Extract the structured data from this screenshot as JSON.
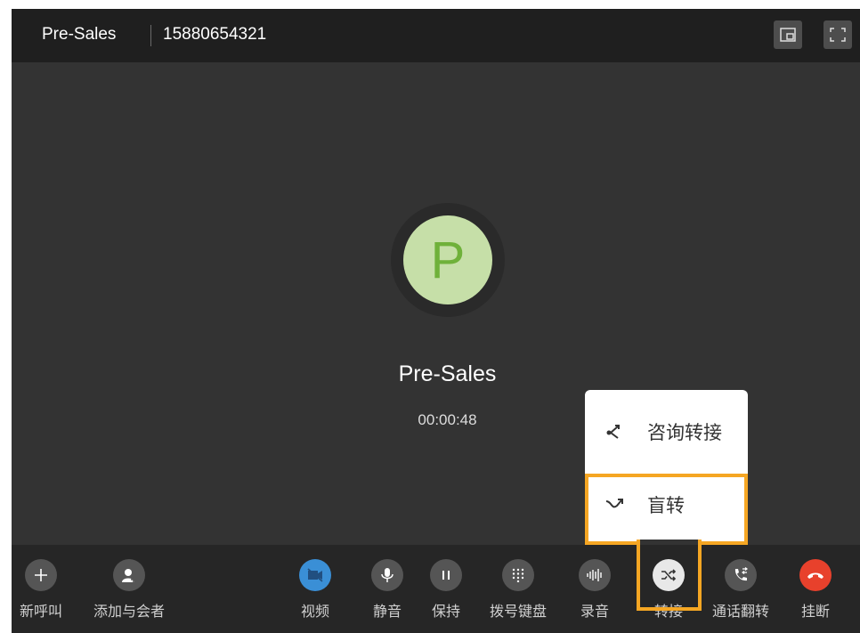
{
  "topbar": {
    "caller_name": "Pre-Sales",
    "caller_number": "15880654321",
    "pip_icon": "picture-in-picture-icon",
    "fullscreen_icon": "fullscreen-icon"
  },
  "call": {
    "avatar_letter": "P",
    "display_name": "Pre-Sales",
    "duration": "00:00:48"
  },
  "transfer_menu": {
    "items": [
      {
        "label": "咨询转接",
        "icon": "attended-transfer-icon"
      },
      {
        "label": "盲转",
        "icon": "blind-transfer-icon"
      }
    ]
  },
  "toolbar": {
    "buttons": [
      {
        "label": "新呼叫",
        "icon": "plus-icon"
      },
      {
        "label": "添加与会者",
        "icon": "add-participant-icon"
      },
      {
        "label": "视频",
        "icon": "video-off-icon"
      },
      {
        "label": "静音",
        "icon": "microphone-icon"
      },
      {
        "label": "保持",
        "icon": "pause-icon"
      },
      {
        "label": "拨号键盘",
        "icon": "dialpad-icon"
      },
      {
        "label": "录音",
        "icon": "waveform-icon"
      },
      {
        "label": "转接",
        "icon": "transfer-icon"
      },
      {
        "label": "通话翻转",
        "icon": "call-flip-icon"
      },
      {
        "label": "挂断",
        "icon": "hangup-icon"
      }
    ]
  },
  "colors": {
    "highlight": "#f5a623",
    "hangup": "#e8412c",
    "video": "#3a8fd6",
    "avatar_bg": "#c6dfa8",
    "avatar_text": "#6fb13a"
  }
}
